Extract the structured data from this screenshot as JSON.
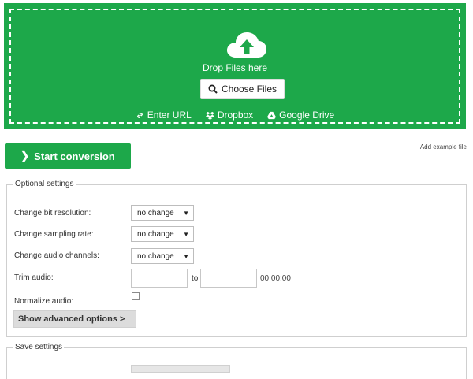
{
  "upload": {
    "drop_text": "Drop Files here",
    "choose_files_label": "Choose Files",
    "sources": [
      {
        "label": "Enter URL",
        "icon": "link-icon"
      },
      {
        "label": "Dropbox",
        "icon": "dropbox-icon"
      },
      {
        "label": "Google Drive",
        "icon": "google-drive-icon"
      }
    ],
    "accent_color": "#1da84a"
  },
  "actions": {
    "start_conversion_label": "Start conversion",
    "add_example_label": "Add example file"
  },
  "optional_settings": {
    "legend": "Optional settings",
    "bit_resolution": {
      "label": "Change bit resolution:",
      "value": "no change"
    },
    "sampling_rate": {
      "label": "Change sampling rate:",
      "value": "no change"
    },
    "audio_channels": {
      "label": "Change audio channels:",
      "value": "no change"
    },
    "trim": {
      "label": "Trim audio:",
      "to_label": "to",
      "time": "00:00:00"
    },
    "normalize": {
      "label": "Normalize audio:",
      "checked": false
    },
    "advanced_label": "Show advanced options >"
  },
  "save_settings": {
    "legend": "Save settings"
  }
}
